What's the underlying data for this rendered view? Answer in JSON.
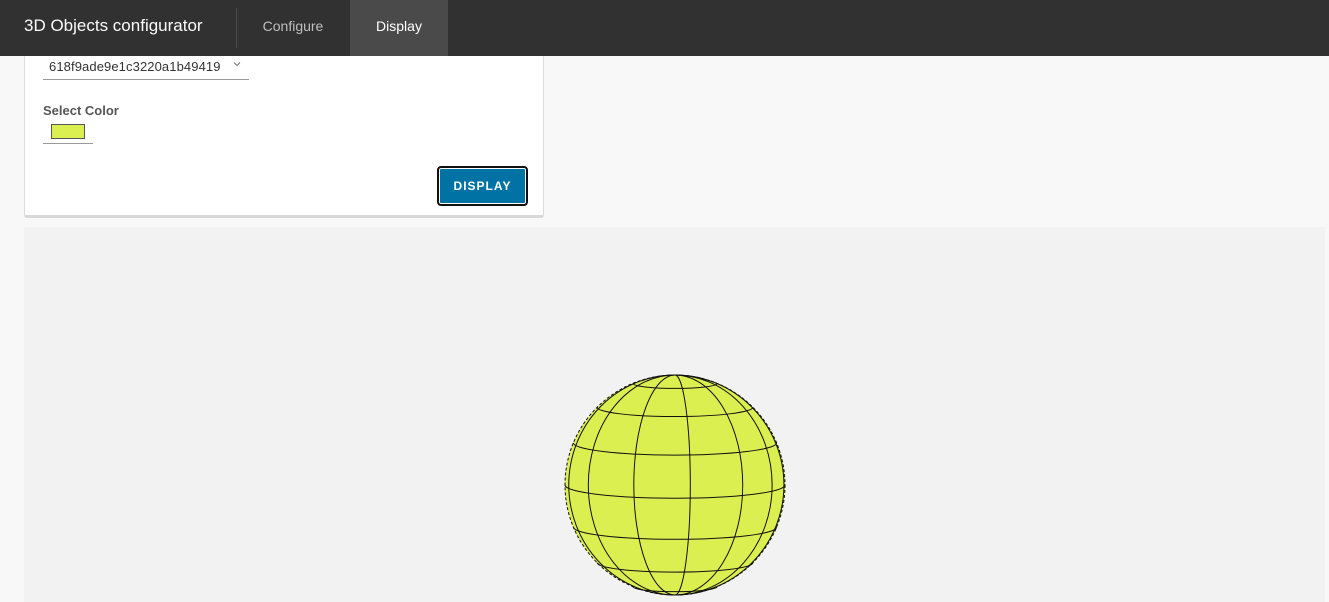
{
  "header": {
    "title": "3D Objects configurator",
    "tabs": [
      {
        "label": "Configure",
        "active": false
      },
      {
        "label": "Display",
        "active": true
      }
    ]
  },
  "form": {
    "object_select": {
      "value": "618f9ade9e1c3220a1b49419"
    },
    "color_label": "Select Color",
    "color_value": "#dcef50",
    "display_button": "DISPLAY"
  },
  "viewport": {
    "object": "sphere",
    "fill_color": "#dcef50",
    "wire_color": "#111111"
  }
}
